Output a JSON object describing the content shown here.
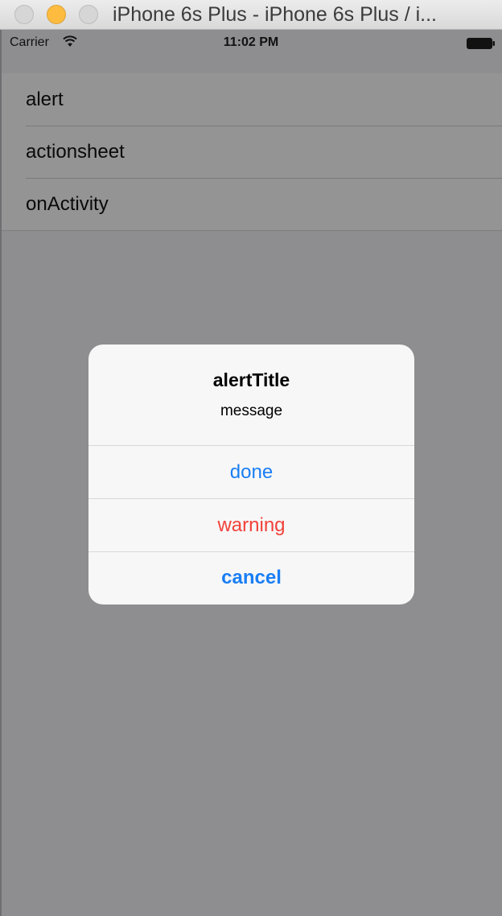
{
  "window": {
    "title": "iPhone 6s Plus - iPhone 6s Plus / i..."
  },
  "statusbar": {
    "carrier": "Carrier",
    "time": "11:02 PM",
    "wifi_icon": "wifi-icon",
    "battery_icon": "battery-icon"
  },
  "list": {
    "items": [
      {
        "label": "alert"
      },
      {
        "label": "actionsheet"
      },
      {
        "label": "onActivity"
      }
    ]
  },
  "alert": {
    "title": "alertTitle",
    "message": "message",
    "buttons": [
      {
        "label": "done",
        "style": "default",
        "color": "#1a7ef5"
      },
      {
        "label": "warning",
        "style": "destructive",
        "color": "#f2413a"
      },
      {
        "label": "cancel",
        "style": "cancel",
        "color": "#1a7ef5"
      }
    ]
  },
  "colors": {
    "dim_background": "#8e8e90",
    "alert_background": "#f7f7f7",
    "tint": "#1a7ef5",
    "destructive": "#f2413a"
  }
}
